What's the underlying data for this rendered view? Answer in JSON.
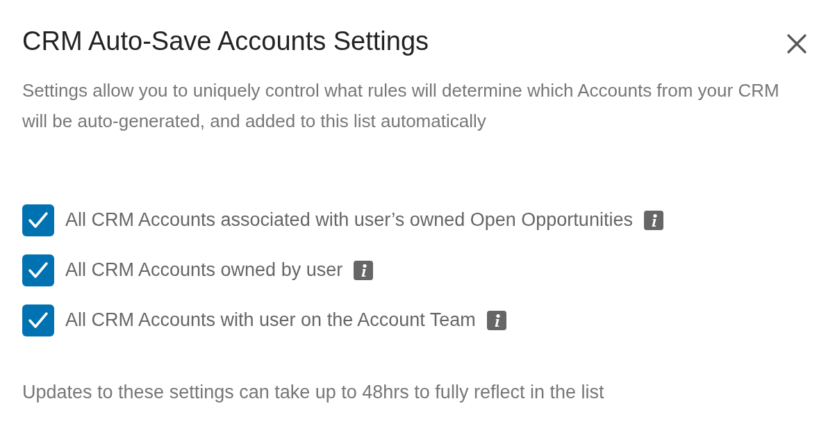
{
  "dialog": {
    "title": "CRM Auto-Save Accounts Settings",
    "description": "Settings allow you to uniquely control what rules will determine which Accounts from your CRM will be auto-generated, and added to this list automatically",
    "options": [
      {
        "label": "All CRM Accounts associated with user’s owned Open Opportunities",
        "checked": true
      },
      {
        "label": "All CRM Accounts owned by user",
        "checked": true
      },
      {
        "label": "All CRM Accounts with user on the Account Team",
        "checked": true
      }
    ],
    "note": "Updates to these settings can take up to 48hrs to fully reflect in the list"
  }
}
